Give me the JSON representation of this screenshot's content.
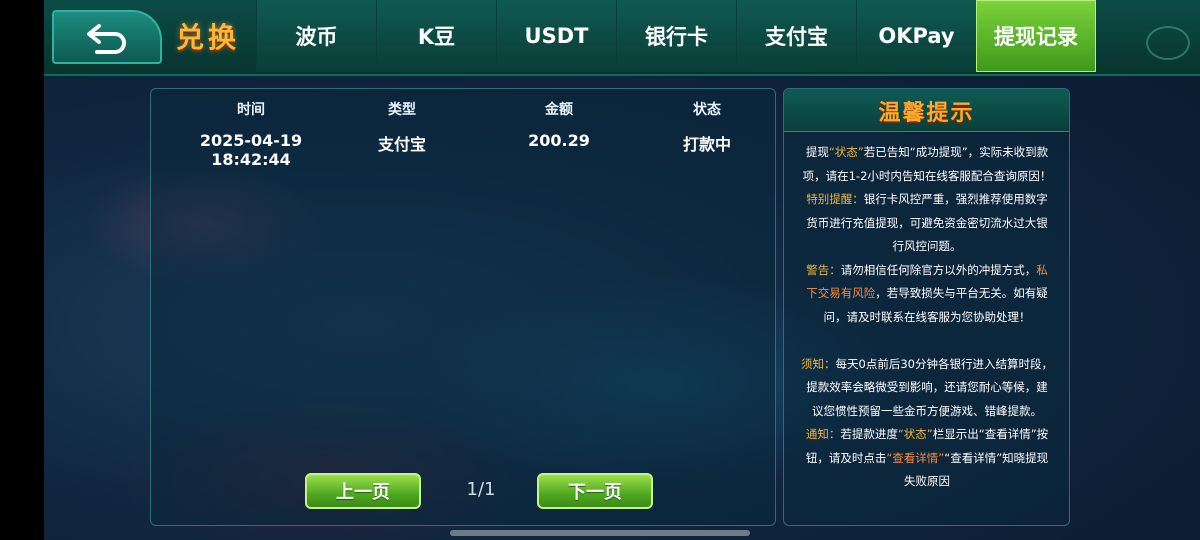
{
  "header": {
    "back_icon": "back-arrow-icon",
    "brand_title": "兑换",
    "tabs": [
      {
        "label": "波币",
        "active": false
      },
      {
        "label": "K豆",
        "active": false
      },
      {
        "label": "USDT",
        "active": false
      },
      {
        "label": "银行卡",
        "active": false
      },
      {
        "label": "支付宝",
        "active": false
      },
      {
        "label": "OKPay",
        "active": false
      },
      {
        "label": "提现记录",
        "active": true
      }
    ]
  },
  "records": {
    "columns": [
      "时间",
      "类型",
      "金额",
      "状态"
    ],
    "rows": [
      {
        "time": "2025-04-19 18:42:44",
        "type": "支付宝",
        "amount": "200.29",
        "status": "打款中"
      }
    ],
    "pager": {
      "prev_label": "上一页",
      "next_label": "下一页",
      "page_text": "1/1"
    }
  },
  "tips": {
    "title": "温馨提示",
    "lines": {
      "l1a": "提现",
      "l1b": "“状态”",
      "l1c": "若已告知“成功提现”，实际未收到款",
      "l2": "项，请在1-2小时内告知在线客服配合查询原因！",
      "l3a": "特别提醒：",
      "l3b": "银行卡风控严重，强烈推荐使用数字",
      "l4": "货币进行充值提现，可避免资金密切流水过大银",
      "l5": "行风控问题。",
      "l6a": "警告：",
      "l6b": "请勿相信任何除官方以外的冲提方式，",
      "l6c": "私",
      "l7a": "下交易有风险",
      "l7b": "，若导致损失与平台无关。如有疑",
      "l8": "问，请及时联系在线客服为您协助处理！",
      "l9a": "须知：",
      "l9b": "每天0点前后30分钟各银行进入结算时段，",
      "l10": "提款效率会略微受到影响，还请您耐心等候，建",
      "l11": "议您惯性预留一些金币方便游戏、错峰提款。",
      "l12a": "通知：",
      "l12b": "若提款进度",
      "l12c": "“状态”",
      "l12d": "栏显示出“查看详情”按",
      "l13a": "钮，请及时点击",
      "l13b": "“查看详情”",
      "l13c": "“查看详情”知晓提现",
      "l14": "失败原因"
    }
  },
  "colors": {
    "accent_gold": "#f2b63a",
    "tab_active": "#5cb82a",
    "nav_bg": "#0c4c46"
  }
}
